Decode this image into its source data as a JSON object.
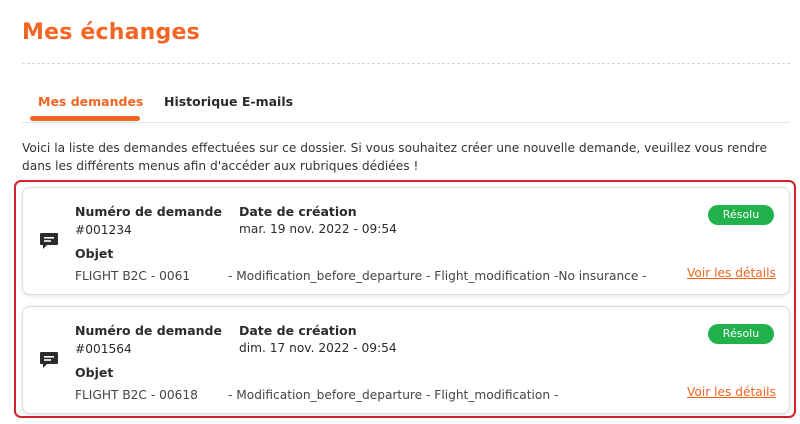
{
  "page": {
    "title": "Mes échanges",
    "tabs": [
      "Mes demandes",
      "Historique E-mails"
    ],
    "intro": "Voici la liste des demandes effectuées sur ce dossier. Si vous souhaitez créer une nouvelle demande, veuillez vous rendre dans les différents menus afin d'accéder aux rubriques dédiées !"
  },
  "labels": {
    "request_number": "Numéro de demande",
    "creation_date": "Date de création",
    "object": "Objet",
    "view_details": "Voir les détails"
  },
  "colors": {
    "accent": "#f26522",
    "status_green": "#22b24c",
    "highlight_border": "#d6202a"
  },
  "requests": [
    {
      "number": "#001234",
      "date": "mar. 19 nov. 2022 - 09:54",
      "status": "Résolu",
      "object_code": "FLIGHT B2C - 0061",
      "object_desc": "- Modification_before_departure - Flight_modification -No insurance -",
      "icon": "chat-icon"
    },
    {
      "number": "#001564",
      "date": "dim. 17 nov. 2022 - 09:54",
      "status": "Résolu",
      "object_code": "FLIGHT B2C - 00618",
      "object_desc": "- Modification_before_departure - Flight_modification -",
      "icon": "chat-icon"
    }
  ]
}
